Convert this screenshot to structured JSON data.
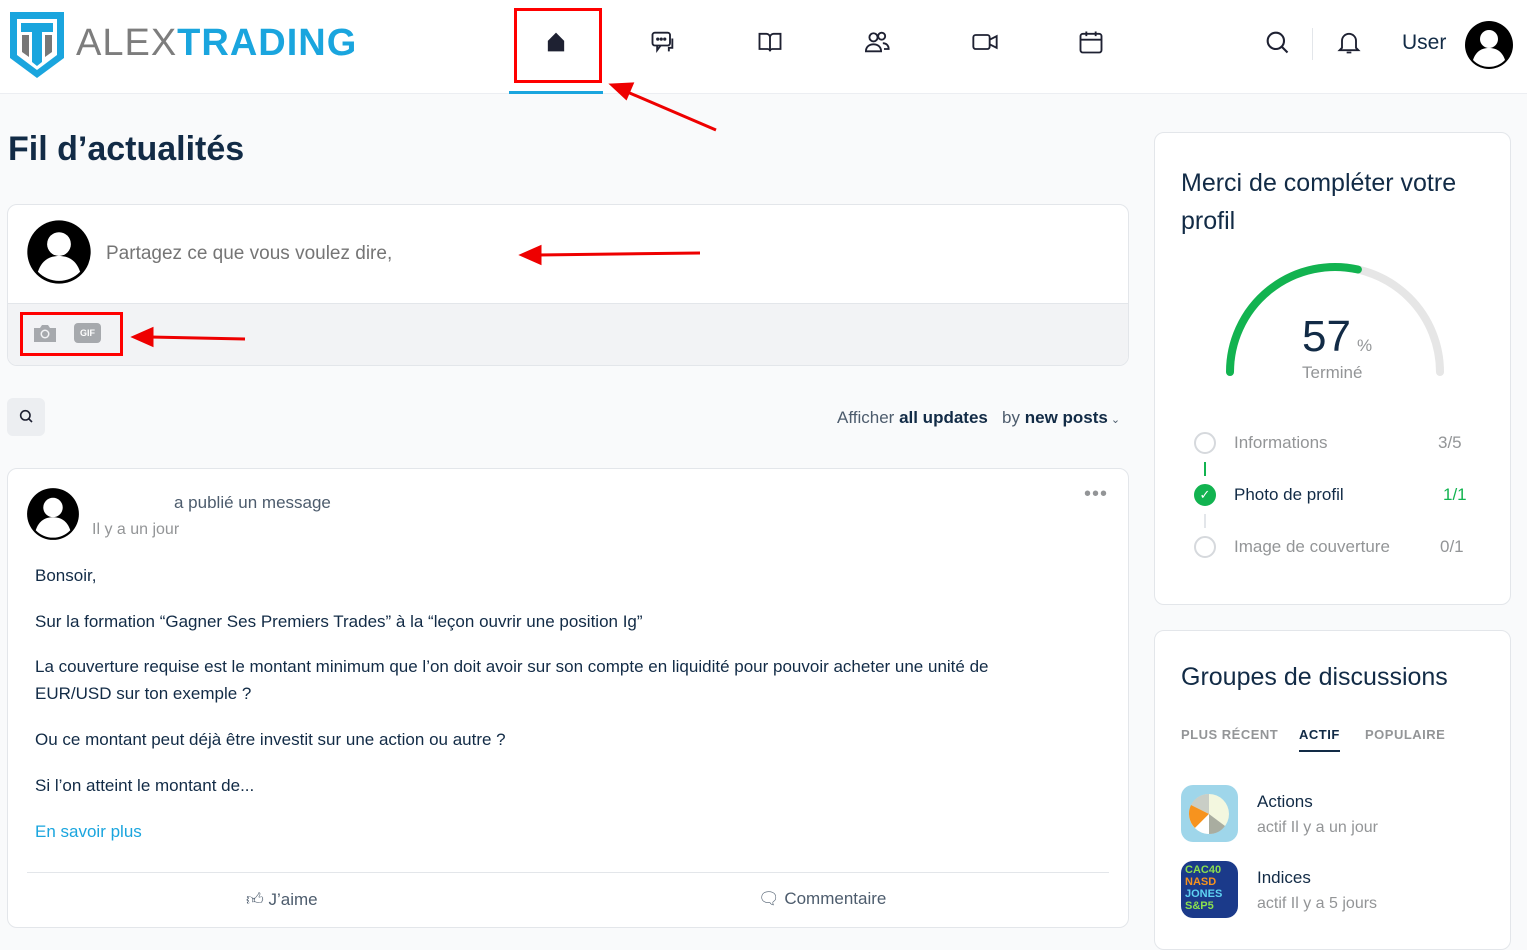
{
  "brand": {
    "part1": "ALEX",
    "part2": "TRADING"
  },
  "header": {
    "user_label": "User"
  },
  "page_title": "Fil d’actualités",
  "composer": {
    "placeholder": "Partagez ce que vous voulez dire,",
    "gif_label": "GIF"
  },
  "filter": {
    "prefix": "Afficher",
    "scope": "all updates",
    "by": "by",
    "order": "new posts"
  },
  "post": {
    "action": "a publié un message",
    "time": "Il y a un jour",
    "paragraphs": [
      "Bonsoir,",
      "Sur la formation “Gagner Ses Premiers Trades” à la “leçon ouvrir une position Ig”",
      "La couverture requise est le montant minimum que l’on doit avoir sur son compte en liquidité pour pouvoir acheter une unité de",
      "EUR/USD sur ton exemple ?",
      "Ou ce montant peut déjà être investit sur une action ou autre ?",
      "Si l’on atteint le montant de..."
    ],
    "read_more": "En savoir plus",
    "like": "J’aime",
    "comment": "Commentaire"
  },
  "profile": {
    "title_line1": "Merci de compléter votre",
    "title_line2": "profil",
    "percent": 57,
    "percent_sign": "%",
    "status": "Terminé",
    "steps": [
      {
        "label": "Informations",
        "count": "3/5",
        "done": false
      },
      {
        "label": "Photo de profil",
        "count": "1/1",
        "done": true
      },
      {
        "label": "Image de couverture",
        "count": "0/1",
        "done": false
      }
    ],
    "accent": "#12b350"
  },
  "groups": {
    "title": "Groupes de discussions",
    "tabs": [
      "PLUS RÉCENT",
      "ACTIF",
      "POPULAIRE"
    ],
    "items": [
      {
        "name": "Actions",
        "activity": "actif Il y a un jour"
      },
      {
        "name": "Indices",
        "activity": "actif Il y a 5 jours"
      }
    ],
    "indices_thumb": [
      "CAC40",
      "NASD",
      "JONES",
      "S&P5"
    ]
  }
}
